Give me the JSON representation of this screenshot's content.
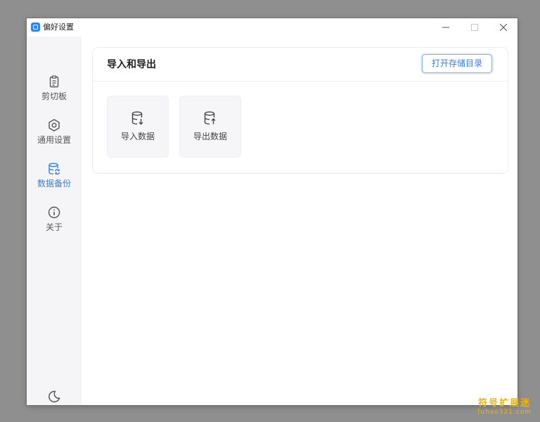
{
  "window": {
    "title": "偏好设置",
    "controls": {
      "minimize_icon": "minimize-icon",
      "maximize_icon": "maximize-icon",
      "close_icon": "close-icon"
    }
  },
  "sidebar": {
    "items": [
      {
        "label": "剪切板",
        "icon": "clipboard-icon",
        "active": false
      },
      {
        "label": "通用设置",
        "icon": "settings-hexagon-icon",
        "active": false
      },
      {
        "label": "数据备份",
        "icon": "database-sync-icon",
        "active": true
      },
      {
        "label": "关于",
        "icon": "info-icon",
        "active": false
      }
    ],
    "theme_toggle_icon": "moon-icon"
  },
  "main": {
    "section_title": "导入和导出",
    "open_storage_button": "打开存储目录",
    "tiles": [
      {
        "label": "导入数据",
        "icon": "database-import-icon"
      },
      {
        "label": "导出数据",
        "icon": "database-export-icon"
      }
    ]
  },
  "watermark": {
    "main": "符号扩展迷",
    "sub": "fuhao321.com"
  },
  "colors": {
    "accent": "#2f7ef5",
    "sidebar_bg": "#f5f5f7",
    "tile_bg": "#f6f6f8",
    "desktop_bg": "#8f8f8f",
    "watermark": "#f2b400"
  }
}
